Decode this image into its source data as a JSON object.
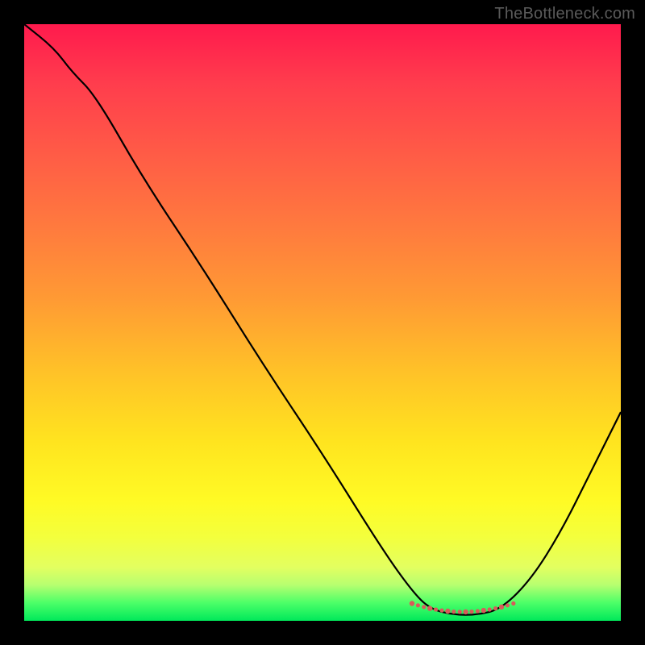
{
  "watermark": "TheBottleneck.com",
  "colors": {
    "frame": "#000000",
    "curve": "#000000",
    "accent_dots": "#d85a5a",
    "gradient_top": "#ff1a4d",
    "gradient_bottom": "#00e85a"
  },
  "chart_data": {
    "type": "line",
    "title": "",
    "xlabel": "",
    "ylabel": "",
    "xlim": [
      0,
      100
    ],
    "ylim": [
      0,
      100
    ],
    "grid": false,
    "legend": "none",
    "series": [
      {
        "name": "bottleneck-curve",
        "x": [
          0,
          5,
          8,
          12,
          20,
          30,
          40,
          50,
          60,
          65,
          68,
          72,
          76,
          80,
          85,
          90,
          95,
          100
        ],
        "values": [
          100,
          96,
          92,
          88,
          74,
          59,
          43,
          28,
          12,
          5,
          2,
          1,
          1,
          2,
          7,
          15,
          25,
          35
        ]
      }
    ],
    "flat_region": {
      "x_start": 65,
      "x_end": 82,
      "y": 1.5
    }
  }
}
